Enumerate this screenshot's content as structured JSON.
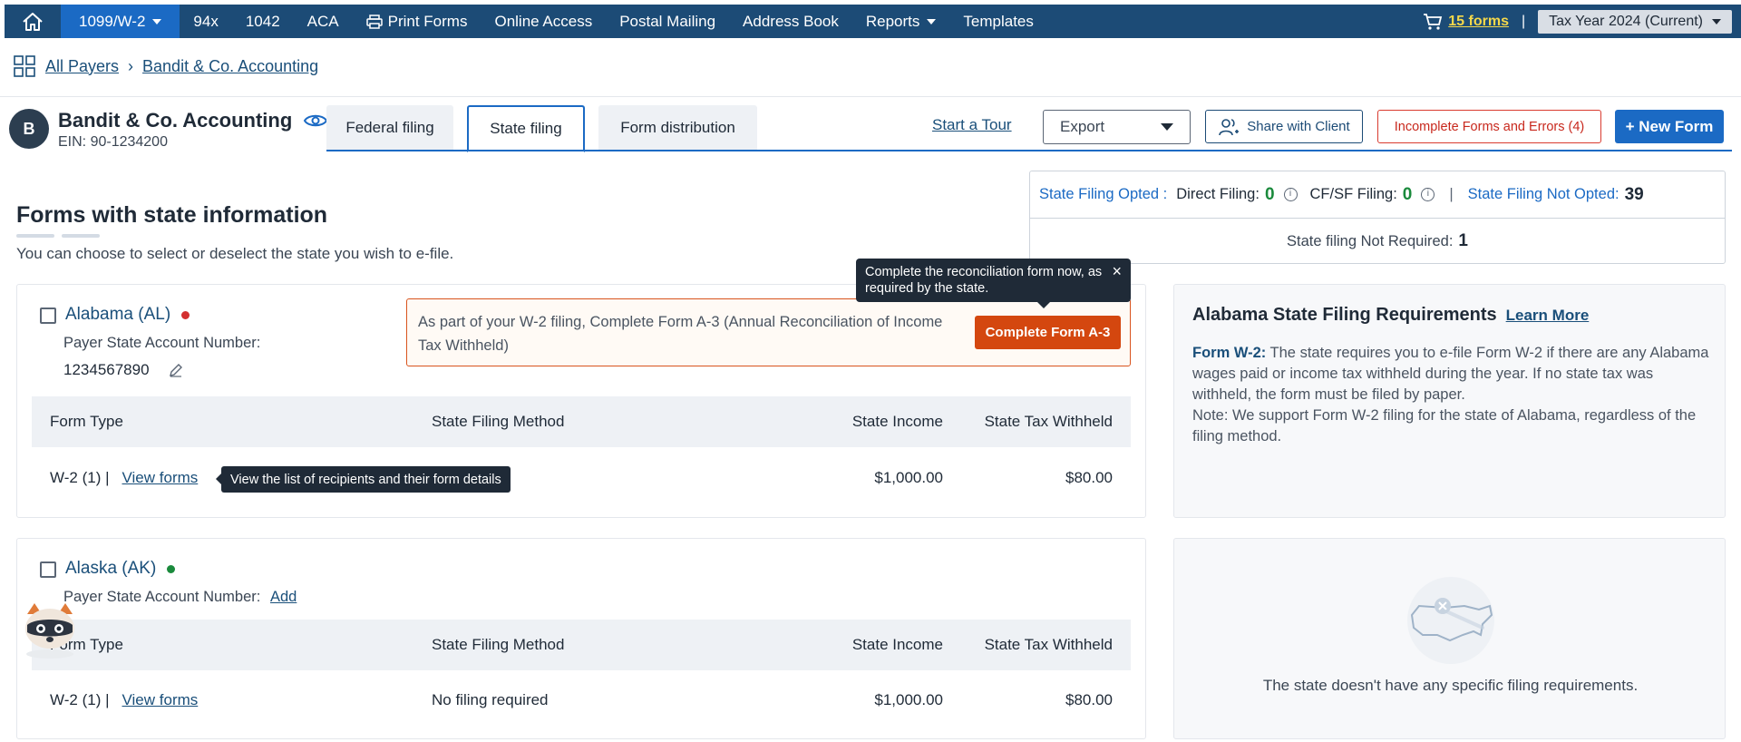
{
  "nav": {
    "items": [
      "1099/W-2",
      "94x",
      "1042",
      "ACA",
      "Print Forms",
      "Online Access",
      "Postal Mailing",
      "Address Book",
      "Reports",
      "Templates"
    ],
    "cart_label": "15 forms",
    "separator": "|",
    "tax_year": "Tax Year 2024 (Current)"
  },
  "breadcrumb": {
    "root": "All Payers",
    "current": "Bandit & Co. Accounting"
  },
  "payer": {
    "initial": "B",
    "name": "Bandit & Co. Accounting",
    "ein": "EIN: 90-1234200"
  },
  "tabs": [
    "Federal filing",
    "State filing",
    "Form distribution"
  ],
  "toolbar": {
    "start_tour": "Start a Tour",
    "export": "Export",
    "share": "Share with Client",
    "incomplete": "Incomplete Forms and Errors (4)",
    "new_form": "+ New Form"
  },
  "section": {
    "title": "Forms with state information",
    "description": "You can choose to select or deselect the state you wish to e-file."
  },
  "stats": {
    "opted_label": "State Filing Opted :",
    "direct_label": "Direct Filing:",
    "direct_value": "0",
    "cfsf_label": "CF/SF Filing:",
    "cfsf_value": "0",
    "divider": "|",
    "not_opted_label": "State Filing Not Opted:",
    "not_opted_value": "39",
    "not_required_label": "State filing Not Required:",
    "not_required_value": "1"
  },
  "table_headers": [
    "Form Type",
    "State Filing Method",
    "State Income",
    "State Tax Withheld"
  ],
  "states": [
    {
      "name": "Alabama (AL)",
      "status_color": "#d32f2f",
      "account_label": "Payer State Account Number:",
      "account_number": "1234567890",
      "alert": "As part of your W-2 filing, Complete Form A-3 (Annual Reconciliation of Income Tax Withheld)",
      "alert_button": "Complete Form A-3",
      "row": {
        "form": "W-2  (1)  |",
        "view": "View forms",
        "method": "",
        "income": "$1,000.00",
        "withheld": "$80.00"
      },
      "view_tooltip": "View the list of recipients and their form details"
    },
    {
      "name": "Alaska (AK)",
      "status_color": "#1a8a3c",
      "account_label": "Payer State Account Number:",
      "account_add": "Add",
      "row": {
        "form": "W-2  (1)  |",
        "view": "View forms",
        "method": "No filing required",
        "income": "$1,000.00",
        "withheld": "$80.00"
      }
    }
  ],
  "reconcile_tooltip": "Complete the reconciliation form now, as required by the state.",
  "requirements": {
    "title": "Alabama State Filing Requirements",
    "learn_more": "Learn More",
    "form_label": "Form W-2:",
    "body": "The state requires you to e-file Form W-2 if there are any Alabama wages paid or income tax withheld during the year. If no state tax was withheld, the form must be filed by paper.",
    "note": "Note: We support Form W-2 filing for the state of Alabama, regardless of the filing method."
  },
  "no_requirements": "The state doesn't have any specific filing requirements."
}
